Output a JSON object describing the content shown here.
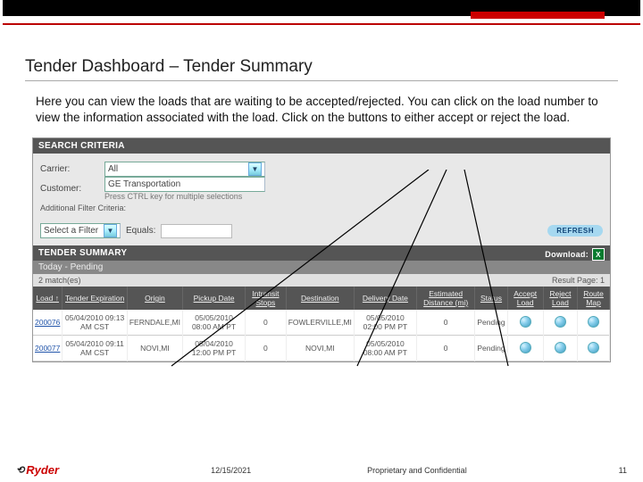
{
  "title": "Tender Dashboard – Tender Summary",
  "description": "Here you can view the loads that are waiting to be accepted/rejected. You can click on the load number to view the information associated with the load. Click on the buttons to either accept or reject the load.",
  "search": {
    "header": "SEARCH CRITERIA",
    "carrier_label": "Carrier:",
    "carrier_value": "All",
    "customer_label": "Customer:",
    "customer_value": "GE Transportation",
    "multi_hint": "Press CTRL key for multiple selections",
    "addl_label": "Additional Filter Criteria:",
    "filter_label": "Select a Filter",
    "equals_label": "Equals:",
    "refresh": "REFRESH"
  },
  "summary": {
    "header": "TENDER SUMMARY",
    "download": "Download:",
    "subhead": "Today - Pending",
    "matches": "2 match(es)",
    "result_page": "Result Page: 1",
    "cols": {
      "load": "Load ↑",
      "tender_exp": "Tender Expiration",
      "origin": "Origin",
      "pickup": "Pickup Date",
      "intransit": "Intransit Stops",
      "dest": "Destination",
      "delivery": "Delivery Date",
      "est": "Estimated Distance (mi)",
      "status": "Status",
      "accept": "Accept Load",
      "reject": "Reject Load",
      "map": "Route Map"
    },
    "rows": [
      {
        "load": "200076",
        "tender_exp": "05/04/2010 09:13 AM CST",
        "origin": "FERNDALE,MI",
        "pickup": "05/05/2010 08:00 AM PT",
        "intransit": "0",
        "dest": "FOWLERVILLE,MI",
        "delivery": "05/05/2010 02:00 PM PT",
        "est": "0",
        "status": "Pending"
      },
      {
        "load": "200077",
        "tender_exp": "05/04/2010 09:11 AM CST",
        "origin": "NOVI,MI",
        "pickup": "05/04/2010 12:00 PM PT",
        "intransit": "0",
        "dest": "NOVI,MI",
        "delivery": "05/05/2010 08:00 AM PT",
        "est": "0",
        "status": "Pending"
      }
    ]
  },
  "footer": {
    "date": "12/15/2021",
    "conf": "Proprietary and Confidential",
    "page": "11",
    "logo": "Ryder"
  }
}
